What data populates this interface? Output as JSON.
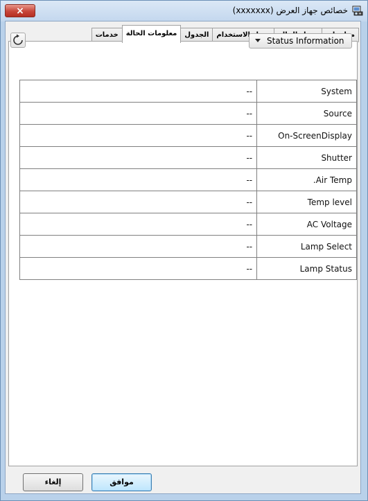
{
  "window": {
    "title": "خصائص جهاز العرض (xxxxxxx)",
    "close_icon": "×"
  },
  "tabs": [
    {
      "label": "معلومات"
    },
    {
      "label": "سجل الحالة"
    },
    {
      "label": "سجل الاستخدام"
    },
    {
      "label": "الجدول"
    },
    {
      "label": "معلومات الحالة",
      "active": true
    },
    {
      "label": "خدمات"
    }
  ],
  "toolbar": {
    "refresh_icon": "refresh-icon",
    "dropdown_selected": "Status Information"
  },
  "status_table": {
    "rows": [
      {
        "name": "System",
        "value": "--"
      },
      {
        "name": "Source",
        "value": "--"
      },
      {
        "name": "On-ScreenDisplay",
        "value": "--"
      },
      {
        "name": "Shutter",
        "value": "--"
      },
      {
        "name": ".Air Temp",
        "value": "--"
      },
      {
        "name": "Temp level",
        "value": "--"
      },
      {
        "name": "AC Voltage",
        "value": "--"
      },
      {
        "name": "Lamp Select",
        "value": "--"
      },
      {
        "name": "Lamp Status",
        "value": "--"
      }
    ]
  },
  "buttons": {
    "ok_label": "موافق",
    "cancel_label": "إلغاء"
  },
  "colors": {
    "frame": "#b9d1ea",
    "close_button": "#c7463a",
    "ok_button": "#bee6fd"
  }
}
